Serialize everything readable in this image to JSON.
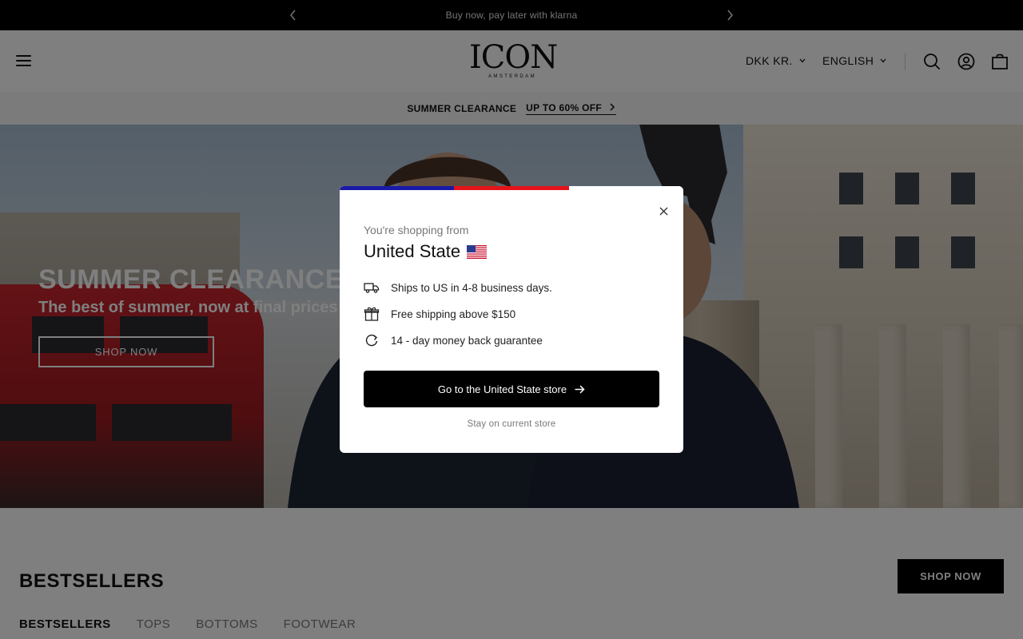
{
  "announcement": {
    "text": "Buy now, pay later with klarna",
    "prev_icon": "chevron-left-icon",
    "next_icon": "chevron-right-icon"
  },
  "header": {
    "logo_main": "ICON",
    "logo_sub": "AMSTERDAM",
    "currency": "DKK KR.",
    "language": "ENGLISH",
    "icons": [
      "menu-icon",
      "search-icon",
      "account-icon",
      "bag-icon"
    ]
  },
  "promo": {
    "label": "SUMMER CLEARANCE",
    "link": "UP TO 60% OFF",
    "link_icon": "chevron-right-icon"
  },
  "hero": {
    "title": "SUMMER CLEARANCE",
    "subtitle": "The best of summer, now at final prices",
    "button": "SHOP NOW"
  },
  "bestsellers": {
    "title": "BESTSELLERS",
    "shop_button": "SHOP NOW",
    "tabs": [
      "BESTSELLERS",
      "TOPS",
      "BOTTOMS",
      "FOOTWEAR"
    ],
    "active_tab": "BESTSELLERS"
  },
  "modal": {
    "pre_title": "You're shopping from",
    "country": "United State",
    "flag_colors": [
      "#1a1aa8",
      "#e5141b",
      "#ffffff"
    ],
    "features": [
      {
        "icon": "truck-icon",
        "text": "Ships to US in 4-8 business days."
      },
      {
        "icon": "gift-icon",
        "text": "Free shipping above $150"
      },
      {
        "icon": "refresh-icon",
        "text": "14 - day money back guarantee"
      }
    ],
    "primary_button": "Go to the United State store",
    "secondary_link": "Stay on current store"
  }
}
